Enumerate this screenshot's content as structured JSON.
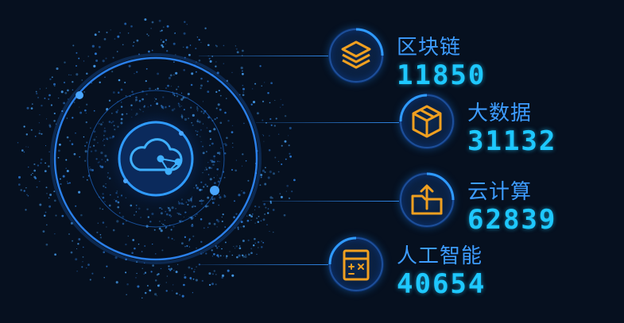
{
  "center": {
    "icon": "cloud-network-icon"
  },
  "items": [
    {
      "label": "区块链",
      "value": "11850",
      "icon": "layers-icon",
      "color": "#f0a020"
    },
    {
      "label": "大数据",
      "value": "31132",
      "icon": "cube-icon",
      "color": "#f0a020"
    },
    {
      "label": "云计算",
      "value": "62839",
      "icon": "folder-upload-icon",
      "color": "#f0a020"
    },
    {
      "label": "人工智能",
      "value": "40654",
      "icon": "calculator-icon",
      "color": "#f0a020"
    }
  ],
  "colors": {
    "background": "#06101f",
    "accent": "#1e90ff",
    "label": "#3d9cff",
    "value": "#1ec8ff",
    "icon": "#f0a020"
  }
}
